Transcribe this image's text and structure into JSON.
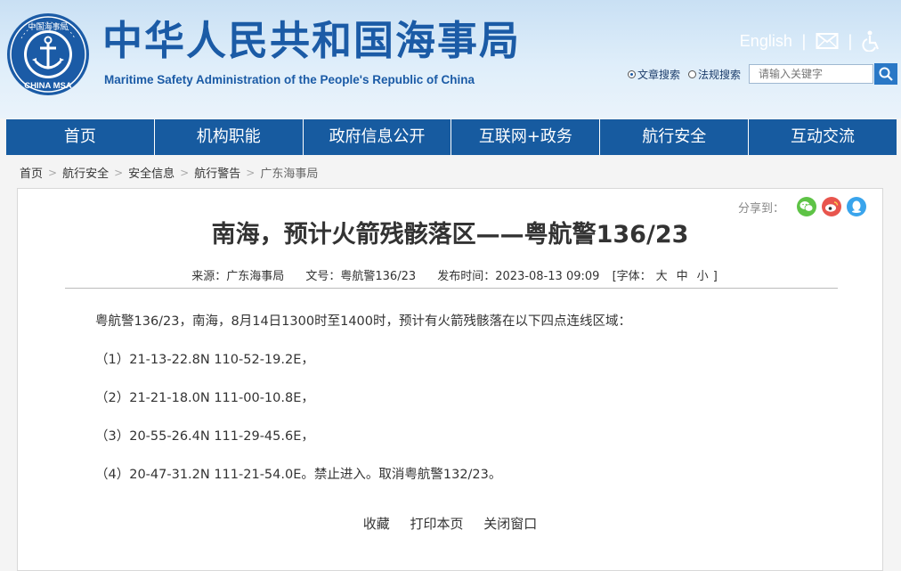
{
  "header": {
    "site_title": "中华人民共和国海事局",
    "site_subtitle": "Maritime Safety Administration of the People's Republic of China",
    "logo_text_top": "中国海事局",
    "logo_text_bottom": "CHINA MSA",
    "english_link": "English",
    "divider": "|",
    "search": {
      "option_article": "文章搜索",
      "option_regulation": "法规搜索",
      "selected": "文章搜索",
      "placeholder": "请输入关键字"
    }
  },
  "nav": {
    "items": [
      "首页",
      "机构职能",
      "政府信息公开",
      "互联网+政务",
      "航行安全",
      "互动交流"
    ]
  },
  "breadcrumb": {
    "items": [
      "首页",
      "航行安全",
      "安全信息",
      "航行警告",
      "广东海事局"
    ],
    "separator": ">"
  },
  "share": {
    "label": "分享到：",
    "icons": [
      "wechat-icon",
      "weibo-icon",
      "qq-icon"
    ]
  },
  "article": {
    "title": "南海，预计火箭残骸落区——粤航警136/23",
    "source": "来源：广东海事局",
    "doc_no": "文号：粤航警136/23",
    "published": "发布时间：2023-08-13 09:09",
    "font_size_label": "[字体：",
    "font_large": "大",
    "font_medium": "中",
    "font_small": "小",
    "font_size_close": "]",
    "paragraphs": [
      "粤航警136/23，南海，8月14日1300时至1400时，预计有火箭残骸落在以下四点连线区域：",
      "（1）21-13-22.8N 110-52-19.2E，",
      "（2）21-21-18.0N 111-00-10.8E，",
      "（3）20-55-26.4N 111-29-45.6E，",
      "（4）20-47-31.2N 111-21-54.0E。禁止进入。取消粤航警132/23。"
    ],
    "actions": {
      "favorite": "收藏",
      "print": "打印本页",
      "close": "关闭窗口"
    }
  },
  "colors": {
    "brand_blue": "#1b5ba6",
    "nav_blue": "#175ba0",
    "wechat_green": "#5ec346",
    "weibo_red": "#e8554d",
    "qq_blue": "#39a4ec"
  }
}
